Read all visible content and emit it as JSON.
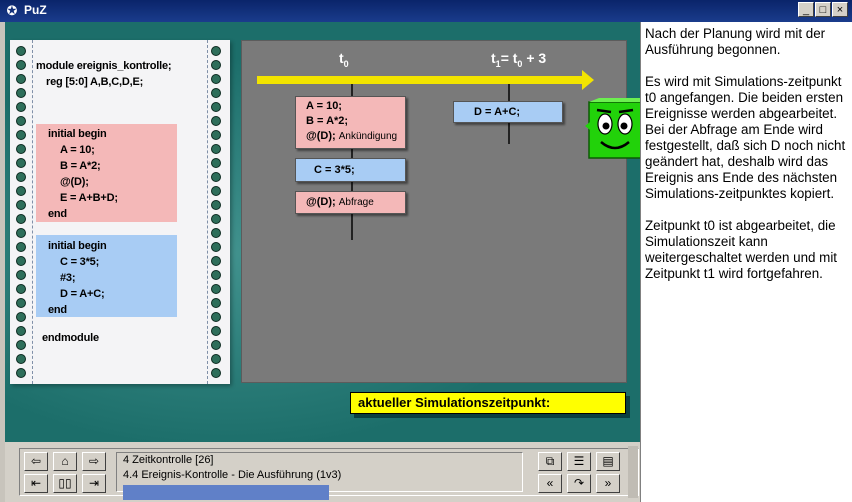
{
  "window": {
    "title": "PuZ",
    "controls": {
      "minimize": "_",
      "maximize": "□",
      "close": "×"
    }
  },
  "code": {
    "header": [
      "module ereignis_kontrolle;",
      "reg [5:0] A,B,C,D,E;"
    ],
    "block1": [
      "initial begin",
      "A = 10;",
      "B = A*2;",
      "@(D);",
      "E = A+B+D;",
      "end"
    ],
    "block2": [
      "initial begin",
      "C = 3*5;",
      "#3;",
      "D = A+C;",
      "end"
    ],
    "footer": "endmodule"
  },
  "timeline": {
    "t0_label": "t",
    "t0_sub": "0",
    "t1_label_a": "t",
    "t1_sub_a": "1",
    "t1_label_eq": "= t",
    "t1_sub_b": "0",
    "t1_label_plus": "+ 3"
  },
  "events_t0": [
    {
      "lines": [
        "A = 10;",
        "B = A*2;"
      ],
      "extra_main": "@(D);",
      "extra_small": "Ankündigung",
      "color": "pink"
    },
    {
      "lines": [
        "C = 3*5;"
      ],
      "color": "blue"
    },
    {
      "extra_main": "@(D);",
      "extra_small": "Abfrage",
      "color": "pink"
    }
  ],
  "events_t1": [
    {
      "lines": [
        "D = A+C;"
      ],
      "color": "blue"
    }
  ],
  "current_time_label": "aktueller Simulationszeitpunkt:",
  "description": [
    "Nach der Planung wird mit der Ausführung begonnen.",
    "Es wird mit Simulations-zeitpunkt t0 angefangen. Die beiden ersten Ereignisse werden abgearbeitet. Bei der Abfrage am Ende wird festgestellt, daß sich D noch nicht geändert hat, deshalb wird das Ereignis ans Ende des nächsten Simulations-zeitpunktes kopiert.",
    "Zeitpunkt t0 ist abgearbeitet, die Simulationszeit kann weitergeschaltet werden und mit Zeitpunkt t1 wird fortgefahren."
  ],
  "navigation": {
    "chapter": "4 Zeitkontrolle [26]",
    "section": "4.4 Ereignis-Kontrolle - Die Ausführung (1v3)"
  },
  "icons": {
    "back": "⇦",
    "home": "⌂",
    "forward": "⇨",
    "first": "⇤",
    "pause": "▯▯",
    "last": "⇥",
    "copy": "⧉",
    "toc": "☰",
    "book": "▤",
    "prev": "«",
    "reload": "↷",
    "next": "»"
  },
  "colors": {
    "teal": "#1c6e6a",
    "pink": "#f4b8b8",
    "blue": "#a8ccf4",
    "yellow": "#ffff00",
    "smiley": "#22d20a"
  }
}
